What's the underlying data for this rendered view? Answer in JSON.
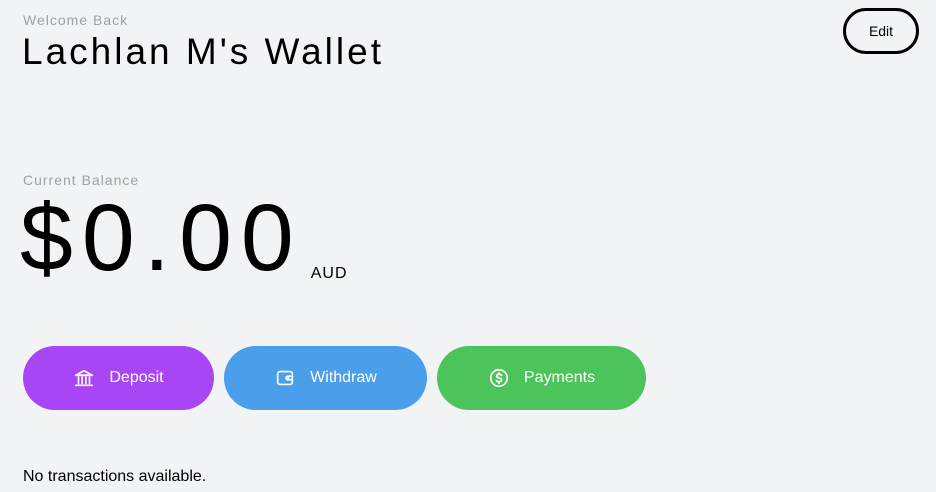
{
  "header": {
    "greeting": "Welcome Back",
    "wallet_title": "Lachlan M's Wallet",
    "edit_label": "Edit"
  },
  "balance": {
    "label": "Current Balance",
    "amount": "$0.00",
    "currency": "AUD"
  },
  "actions": {
    "deposit": {
      "label": "Deposit",
      "icon": "bank-icon",
      "color": "#a845f5"
    },
    "withdraw": {
      "label": "Withdraw",
      "icon": "wallet-icon",
      "color": "#4a9eea"
    },
    "payments": {
      "label": "Payments",
      "icon": "dollar-circle-icon",
      "color": "#4cc45b"
    }
  },
  "transactions": {
    "empty_message": "No transactions available."
  }
}
